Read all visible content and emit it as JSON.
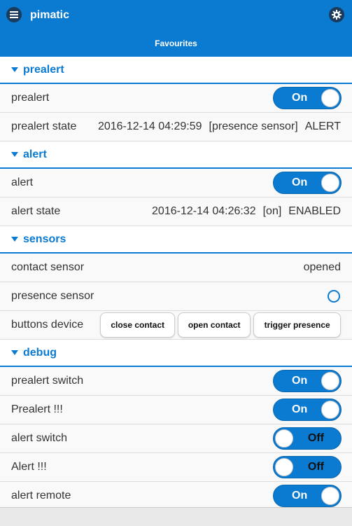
{
  "header": {
    "app_title": "pimatic",
    "page_tab": "Favourites",
    "menu_icon": "hamburger-menu-icon",
    "settings_icon": "gear-icon",
    "accent_color": "#0b7ad1"
  },
  "groups": [
    {
      "title": "prealert",
      "rows": [
        {
          "label": "prealert",
          "type": "switch",
          "state": "On"
        },
        {
          "label": "prealert state",
          "type": "text",
          "time": "2016-12-14 04:29:59",
          "source": "[presence sensor]",
          "status": "ALERT"
        }
      ]
    },
    {
      "title": "alert",
      "rows": [
        {
          "label": "alert",
          "type": "switch",
          "state": "On"
        },
        {
          "label": "alert state",
          "type": "text",
          "time": "2016-12-14 04:26:32",
          "source": "[on]",
          "status": "ENABLED"
        }
      ]
    },
    {
      "title": "sensors",
      "rows": [
        {
          "label": "contact sensor",
          "type": "text",
          "value": "opened"
        },
        {
          "label": "presence sensor",
          "type": "presence",
          "value": ""
        },
        {
          "label": "buttons device",
          "type": "buttons",
          "buttons": [
            "close contact",
            "open contact",
            "trigger presence"
          ]
        }
      ]
    },
    {
      "title": "debug",
      "rows": [
        {
          "label": "prealert switch",
          "type": "switch",
          "state": "On"
        },
        {
          "label": "Prealert !!!",
          "type": "switch",
          "state": "On"
        },
        {
          "label": "alert switch",
          "type": "switch",
          "state": "Off"
        },
        {
          "label": "Alert !!!",
          "type": "switch",
          "state": "Off"
        },
        {
          "label": "alert remote",
          "type": "switch",
          "state": "On"
        }
      ]
    }
  ]
}
